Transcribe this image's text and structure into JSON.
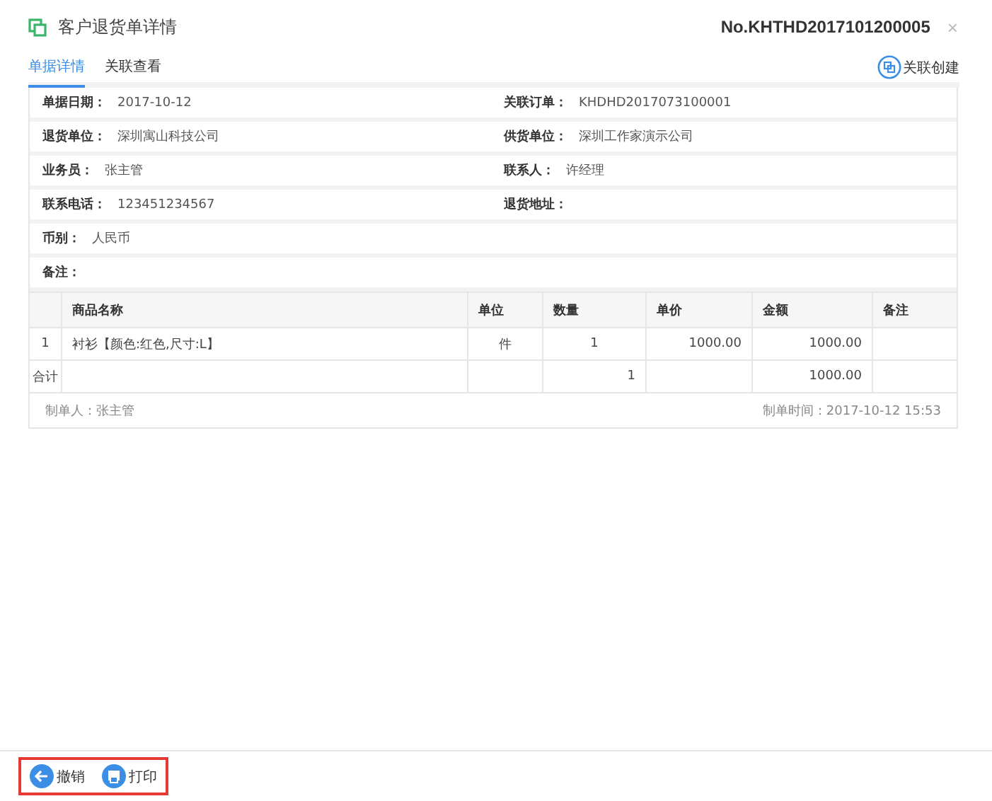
{
  "header": {
    "title": "客户退货单详情",
    "number": "No.KHTHD2017101200005",
    "close": "×"
  },
  "tabs": [
    {
      "label": "单据详情",
      "selected": true
    },
    {
      "label": "关联查看",
      "selected": false
    }
  ],
  "link_create": "关联创建",
  "fields": [
    [
      {
        "label": "单据日期：",
        "value": "2017-10-12"
      },
      {
        "label": "关联订单：",
        "value": "KHDHD2017073100001"
      }
    ],
    [
      {
        "label": "退货单位：",
        "value": "深圳寓山科技公司"
      },
      {
        "label": "供货单位：",
        "value": "深圳工作家演示公司"
      }
    ],
    [
      {
        "label": "业务员：",
        "value": "张主管"
      },
      {
        "label": "联系人：",
        "value": "许经理"
      }
    ],
    [
      {
        "label": "联系电话：",
        "value": "123451234567"
      },
      {
        "label": "退货地址："
      }
    ],
    [
      {
        "label": "币别：",
        "value": "人民币"
      }
    ],
    [
      {
        "label": "备注："
      }
    ]
  ],
  "table": {
    "columns": [
      null,
      "商品名称",
      "单位",
      "数量",
      "单价",
      "金额",
      "备注"
    ],
    "rows": [
      [
        "1",
        "衬衫【颜色:红色,尺寸:L】",
        "件",
        "1",
        "1000.00",
        "1000.00",
        null
      ]
    ],
    "total": {
      "label": "合计",
      "quantity": "1",
      "amount": "1000.00"
    }
  },
  "footer": {
    "maker": "制单人：张主管",
    "time": "制单时间：2017-10-12 15:53"
  },
  "buttons": [
    {
      "kind": "back",
      "label": "撤销"
    },
    {
      "kind": "print",
      "label": "打印"
    }
  ]
}
